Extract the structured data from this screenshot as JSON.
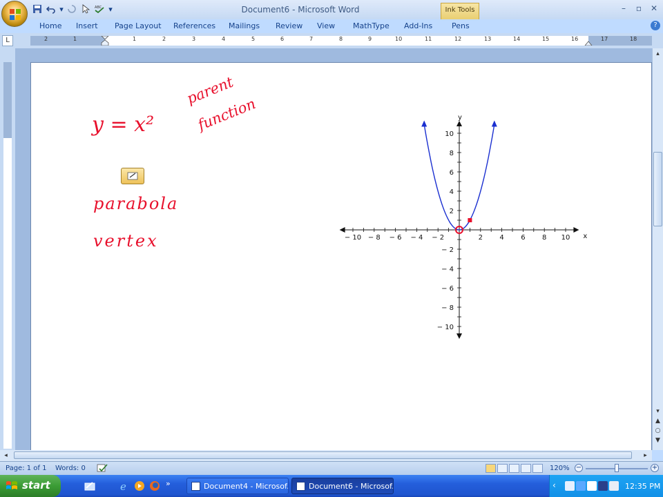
{
  "titlebar": {
    "document_title": "Document6 - Microsoft Word",
    "contextual_tab_group": "Ink Tools"
  },
  "ribbon_tabs": [
    "Home",
    "Insert",
    "Page Layout",
    "References",
    "Mailings",
    "Review",
    "View",
    "MathType",
    "Add-Ins",
    "Pens"
  ],
  "ruler": {
    "numbers": [
      "2",
      "1",
      "1",
      "2",
      "3",
      "4",
      "5",
      "6",
      "7",
      "8",
      "9",
      "10",
      "11",
      "12",
      "13",
      "14",
      "15",
      "16",
      "17",
      "18"
    ]
  },
  "ink": {
    "equation": "y = x²",
    "note1_line1": "parent",
    "note1_line2": "function",
    "word1": "parabola",
    "word2": "vertex"
  },
  "chart_data": {
    "type": "line",
    "title": "",
    "series": [
      {
        "x": [
          -3.3,
          -3,
          -2,
          -1,
          0,
          1,
          2,
          3,
          3.3
        ],
        "y": [
          10.9,
          9,
          4,
          1,
          0,
          1,
          4,
          9,
          10.9
        ]
      }
    ],
    "xlim": [
      -10,
      10
    ],
    "ylim": [
      -10,
      10
    ],
    "xticks": [
      "− 10",
      "− 8",
      "− 6",
      "− 4",
      "− 2",
      "2",
      "4",
      "6",
      "8",
      "10"
    ],
    "yticks": [
      "10",
      "8",
      "6",
      "4",
      "2",
      "− 2",
      "− 4",
      "− 6",
      "− 8",
      "− 10"
    ],
    "xlabel": "x",
    "ylabel": "y",
    "vertex": {
      "x": 0,
      "y": 0
    },
    "marker_point": {
      "x": 1,
      "y": 1
    }
  },
  "statusbar": {
    "page": "Page: 1 of 1",
    "words": "Words: 0",
    "zoom": "120%"
  },
  "taskbar": {
    "start_label": "start",
    "tasks": [
      "Document4 - Microsof...",
      "Document6 - Microsof..."
    ],
    "clock": "12:35 PM"
  },
  "colors": {
    "ink": "#e8102c",
    "curve": "#1a2fd0",
    "vertex_circle": "#e8102c"
  }
}
